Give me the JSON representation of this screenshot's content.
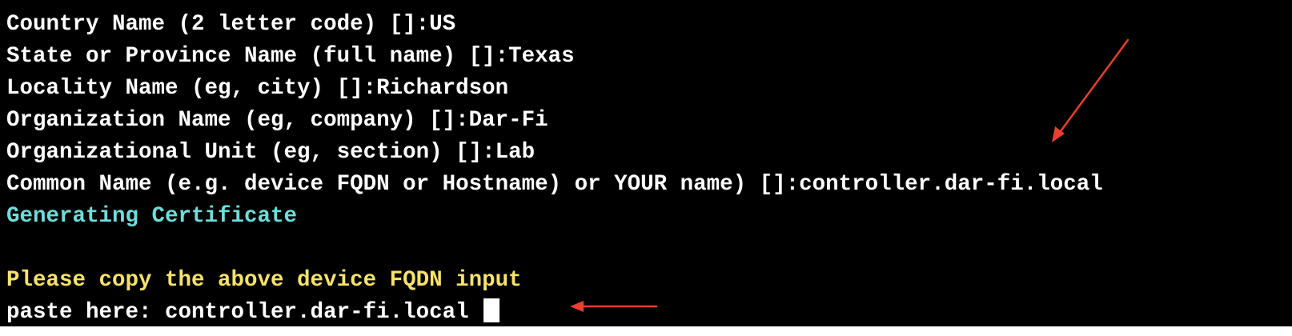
{
  "terminal": {
    "lines": [
      "Country Name (2 letter code) []:US",
      "State or Province Name (full name) []:Texas",
      "Locality Name (eg, city) []:Richardson",
      "Organization Name (eg, company) []:Dar-Fi",
      "Organizational Unit (eg, section) []:Lab",
      "Common Name (e.g. device FQDN or Hostname) or YOUR name) []:controller.dar-fi.local",
      "Generating Certificate",
      "",
      "Please copy the above device FQDN input",
      "paste here: controller.dar-fi.local "
    ]
  },
  "colors": {
    "background": "#000000",
    "text": "#ffffff",
    "info": "#6fdcdc",
    "prompt": "#f7e26b",
    "annotation_arrow": "#e8402f"
  },
  "icons": {
    "annotation_1": "arrow-down-left-icon",
    "annotation_2": "arrow-left-icon",
    "cursor": "block-cursor"
  }
}
